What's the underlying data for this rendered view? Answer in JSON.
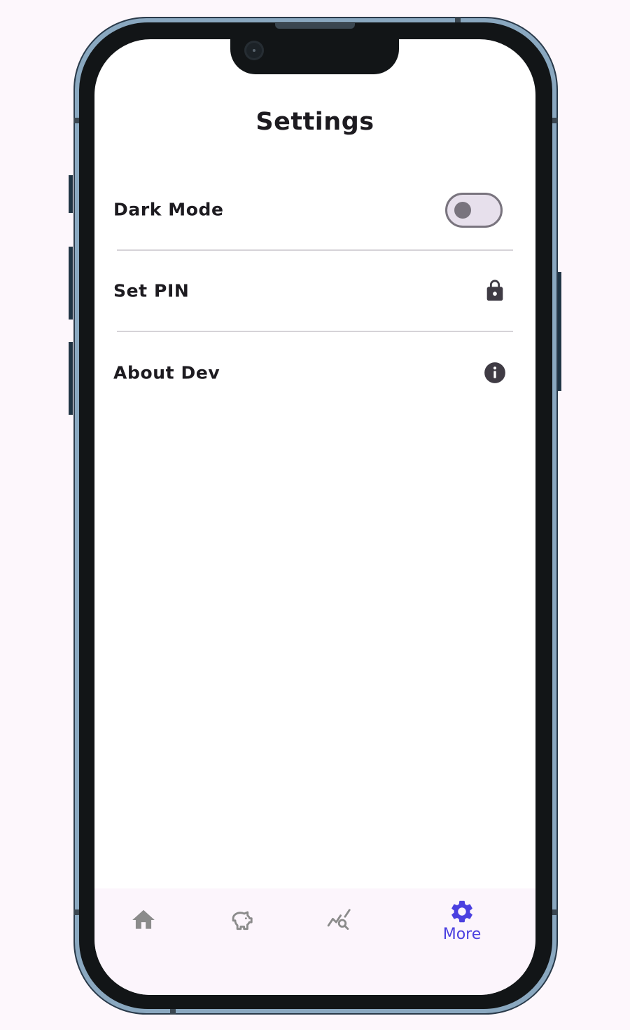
{
  "screen": {
    "title": "Settings"
  },
  "settings": {
    "items": [
      {
        "label": "Dark Mode",
        "control": "toggle",
        "value": false
      },
      {
        "label": "Set PIN",
        "icon": "lock-icon"
      },
      {
        "label": "About Dev",
        "icon": "info-icon"
      }
    ]
  },
  "bottom_nav": {
    "items": [
      {
        "icon": "home-icon",
        "label": "",
        "selected": false
      },
      {
        "icon": "piggy-bank-icon",
        "label": "",
        "selected": false
      },
      {
        "icon": "analytics-search-icon",
        "label": "",
        "selected": false
      },
      {
        "icon": "gear-icon",
        "label": "More",
        "selected": true
      }
    ]
  },
  "colors": {
    "page_background": "#fdf7fc",
    "screen_background": "#ffffff",
    "text_primary": "#1d1b20",
    "accent": "#4b40e0",
    "inactive_icon": "#8b8b8b",
    "toggle_track": "#e7e0ec",
    "toggle_outline": "#79747e",
    "divider": "#d6d3d8",
    "nav_background": "#fcf5fc",
    "frame_outer": "#8aa8c0",
    "bezel": "#121517"
  }
}
